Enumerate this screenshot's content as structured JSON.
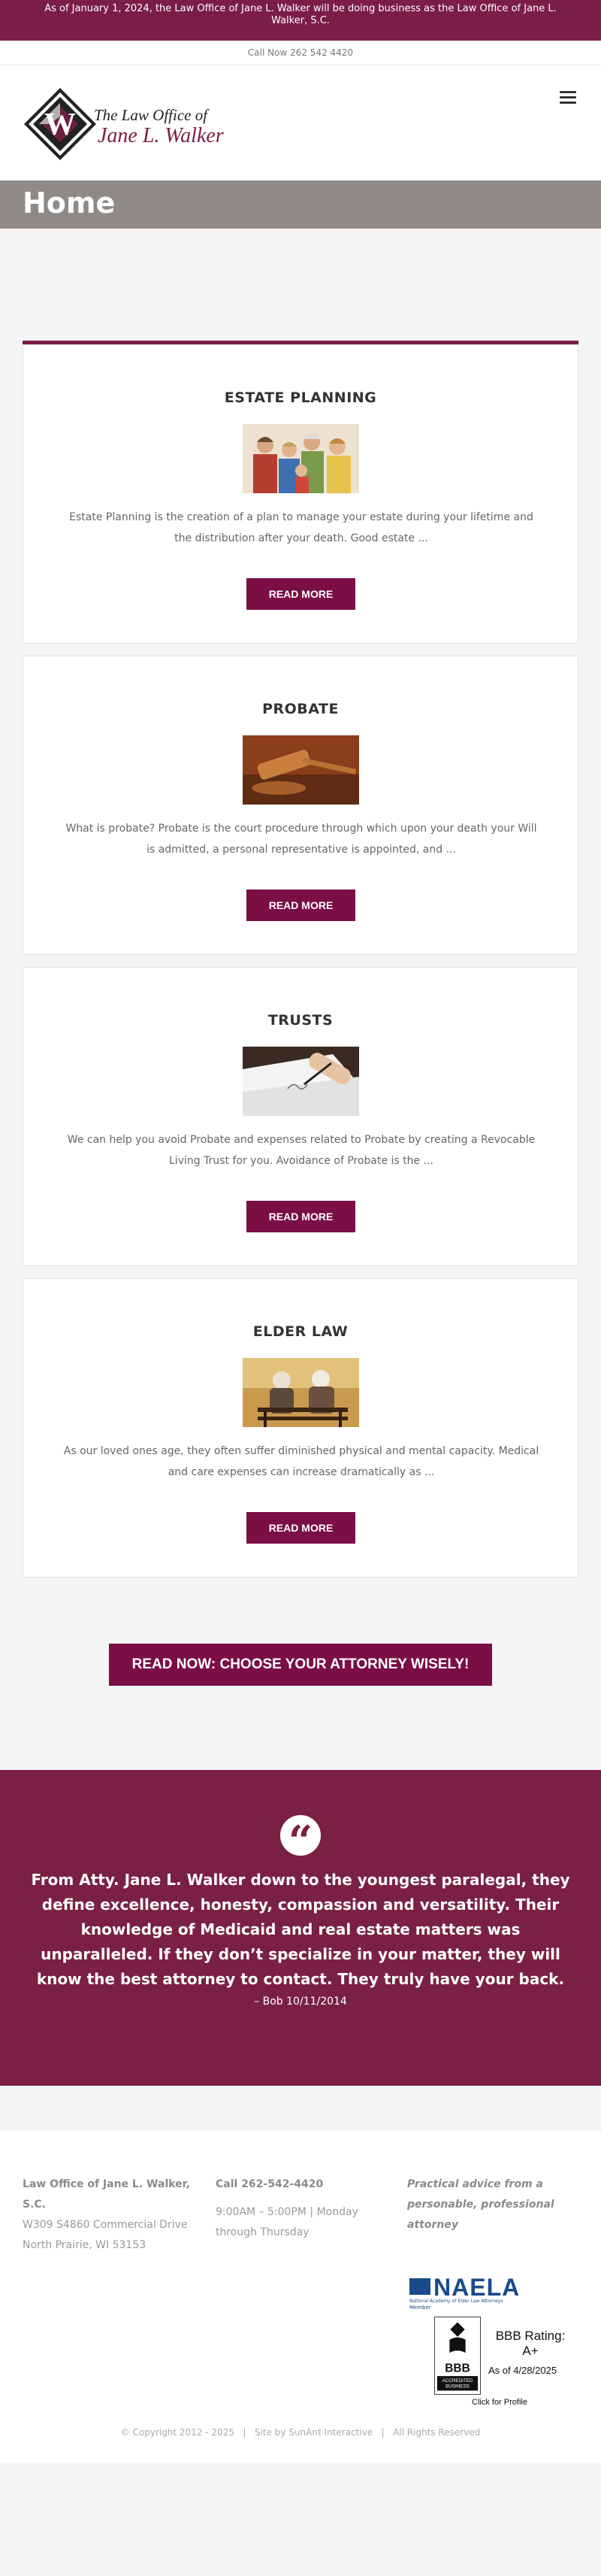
{
  "announcement": {
    "text": "As of January 1, 2024, the Law Office of Jane L. Walker will be doing business as the Law Office of Jane L. Walker, S.C."
  },
  "call_bar": {
    "text": "Call Now 262 542 4420"
  },
  "logo": {
    "line1": "The Law Office of",
    "line2": "Jane L. Walker"
  },
  "page_title": "Home",
  "services": [
    {
      "title": "ESTATE PLANNING",
      "excerpt": "Estate Planning is the creation of a plan to manage your estate during your lifetime and the distribution after your death. Good estate ...",
      "button": "READ MORE",
      "image": "family-photo"
    },
    {
      "title": "PROBATE",
      "excerpt": "What is probate? Probate is the court procedure through which upon your death your Will is admitted, a personal representative is appointed, and ...",
      "button": "READ MORE",
      "image": "gavel-photo"
    },
    {
      "title": "TRUSTS",
      "excerpt": "We can help you avoid Probate and expenses related to Probate by creating a Revocable Living Trust for you. Avoidance of Probate is the ...",
      "button": "READ MORE",
      "image": "signing-document-photo"
    },
    {
      "title": "ELDER LAW",
      "excerpt": "As our loved ones age, they often suffer diminished physical and mental capacity. Medical and care expenses can increase dramatically as ...",
      "button": "READ MORE",
      "image": "elderly-couple-photo"
    }
  ],
  "cta": {
    "label": "READ NOW: CHOOSE YOUR ATTORNEY WISELY!"
  },
  "testimonial": {
    "quote": "From Atty. Jane L. Walker down to the youngest paralegal, they define excellence, honesty, compassion and versatility. Their knowledge of Medicaid and real estate matters was unparalleled. If they don’t specialize in your matter, they will know the best attorney to contact. They truly have your back.",
    "author": "– Bob 10/11/2014"
  },
  "footer": {
    "firm_name": "Law Office of Jane L. Walker, S.C.",
    "address1": "W309 S4860 Commercial Drive",
    "address2": "North Prairie, WI 53153",
    "phone": "Call 262-542-4420",
    "hours": "9:00AM – 5:00PM | Monday through Thursday",
    "tagline": "Practical advice from a personable, professional attorney",
    "naela": {
      "name": "NAELA",
      "subtitle": "National Academy of Elder Law Attorneys",
      "member": "Member"
    },
    "bbb": {
      "rating": "BBB Rating: A+",
      "as_of": "As of 4/28/2025",
      "profile_link": "Click for Profile",
      "seal_text": "ACCREDITED BUSINESS"
    },
    "copyright": "© Copyright 2012 - 2025",
    "site_by": "Site by SunAnt Interactive",
    "rights": "All Rights Reserved",
    "separator": "|"
  },
  "colors": {
    "brand": "#7a1d47",
    "button": "#7a0e45",
    "title_bar": "#8e8a87",
    "testimonial_bg": "#7a2143"
  },
  "icons": {
    "menu": "hamburger-icon",
    "quote": "quote-icon"
  }
}
